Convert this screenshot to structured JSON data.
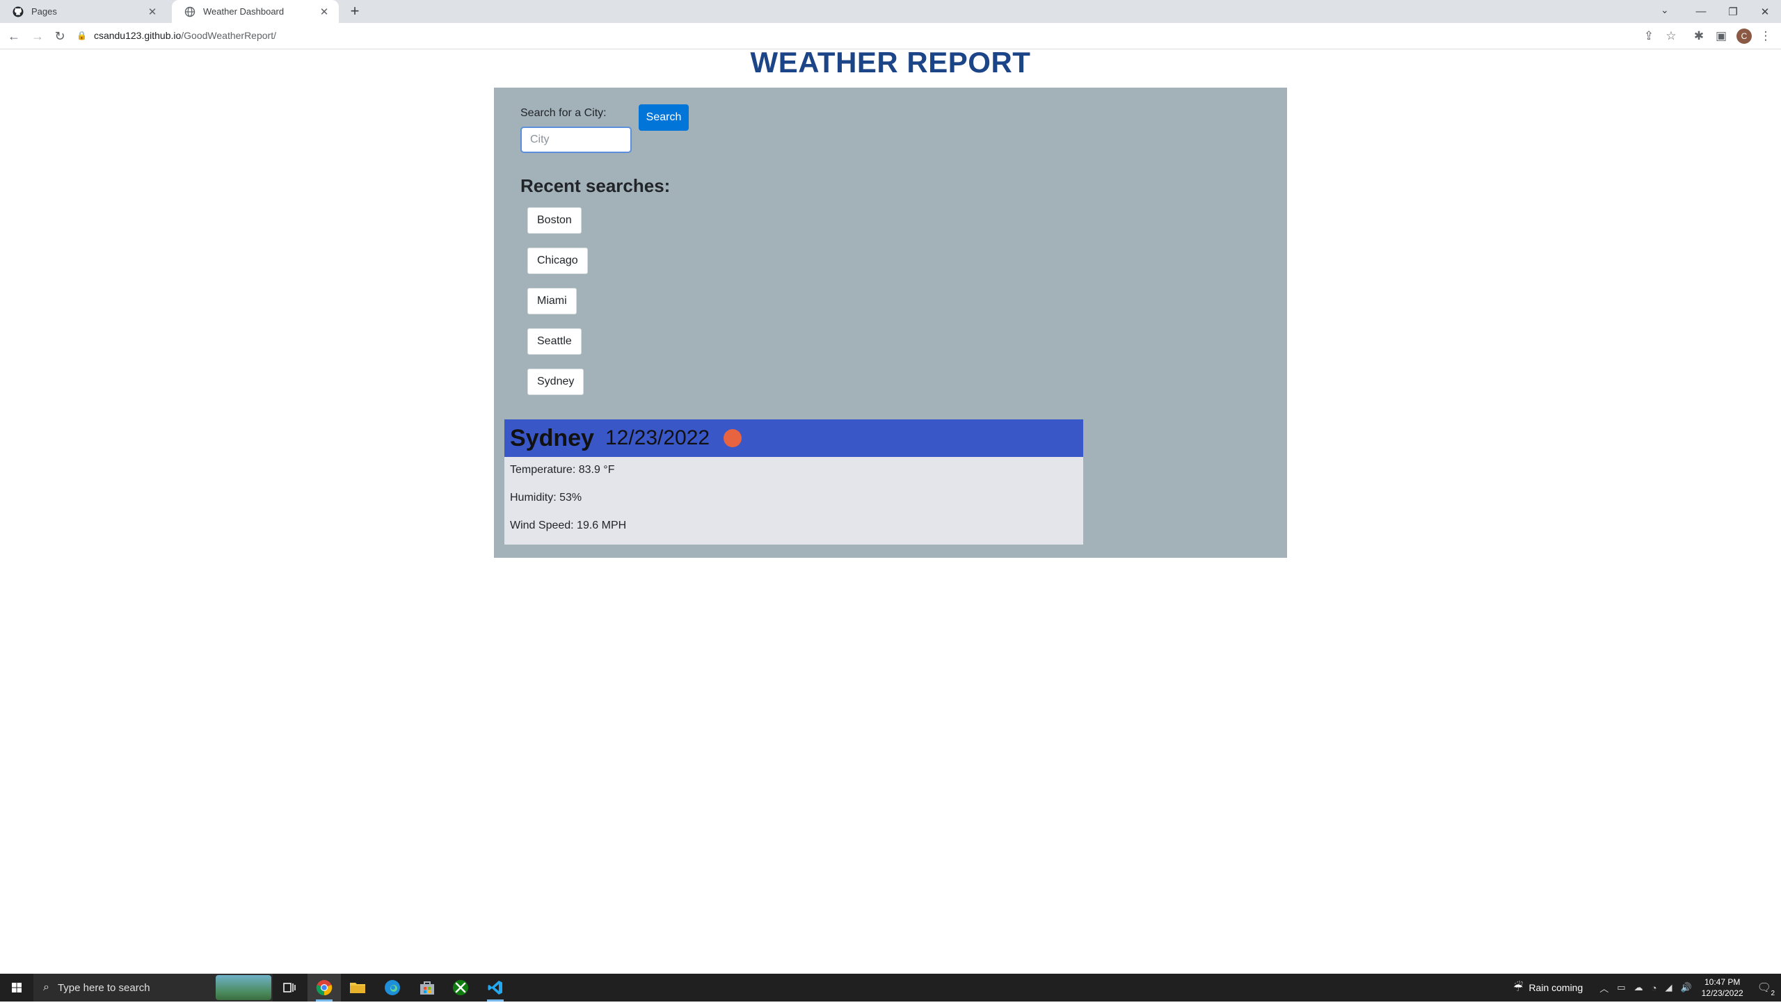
{
  "browser": {
    "tabs": [
      {
        "title": "Pages",
        "active": false,
        "icon": "github-icon"
      },
      {
        "title": "Weather Dashboard",
        "active": true,
        "icon": "globe-icon"
      }
    ],
    "new_tab": "+",
    "close_glyph": "✕",
    "url_host": "csandu123.github.io",
    "url_path": "/GoodWeatherReport/",
    "profile_initial": "C"
  },
  "page": {
    "title": "WEATHER REPORT",
    "search": {
      "label": "Search for a City:",
      "placeholder": "City",
      "value": "",
      "button_label": "Search"
    },
    "recent": {
      "title": "Recent searches:",
      "items": [
        "Boston",
        "Chicago",
        "Miami",
        "Seattle",
        "Sydney"
      ]
    },
    "current": {
      "city": "Sydney",
      "date": "12/23/2022",
      "icon": "sun-icon",
      "temperature": "Temperature: 83.9 °F",
      "humidity": "Humidity: 53%",
      "wind": "Wind Speed: 19.6 MPH"
    },
    "colors": {
      "title": "#1c4587",
      "panel": "#a3b2b9",
      "card_header": "#3a57c8",
      "search_button": "#0275d8",
      "weather_icon": "#e8633f"
    }
  },
  "taskbar": {
    "search_placeholder": "Type here to search",
    "weather_text": "Rain coming",
    "time": "10:47 PM",
    "date": "12/23/2022",
    "notification_count": "2"
  }
}
